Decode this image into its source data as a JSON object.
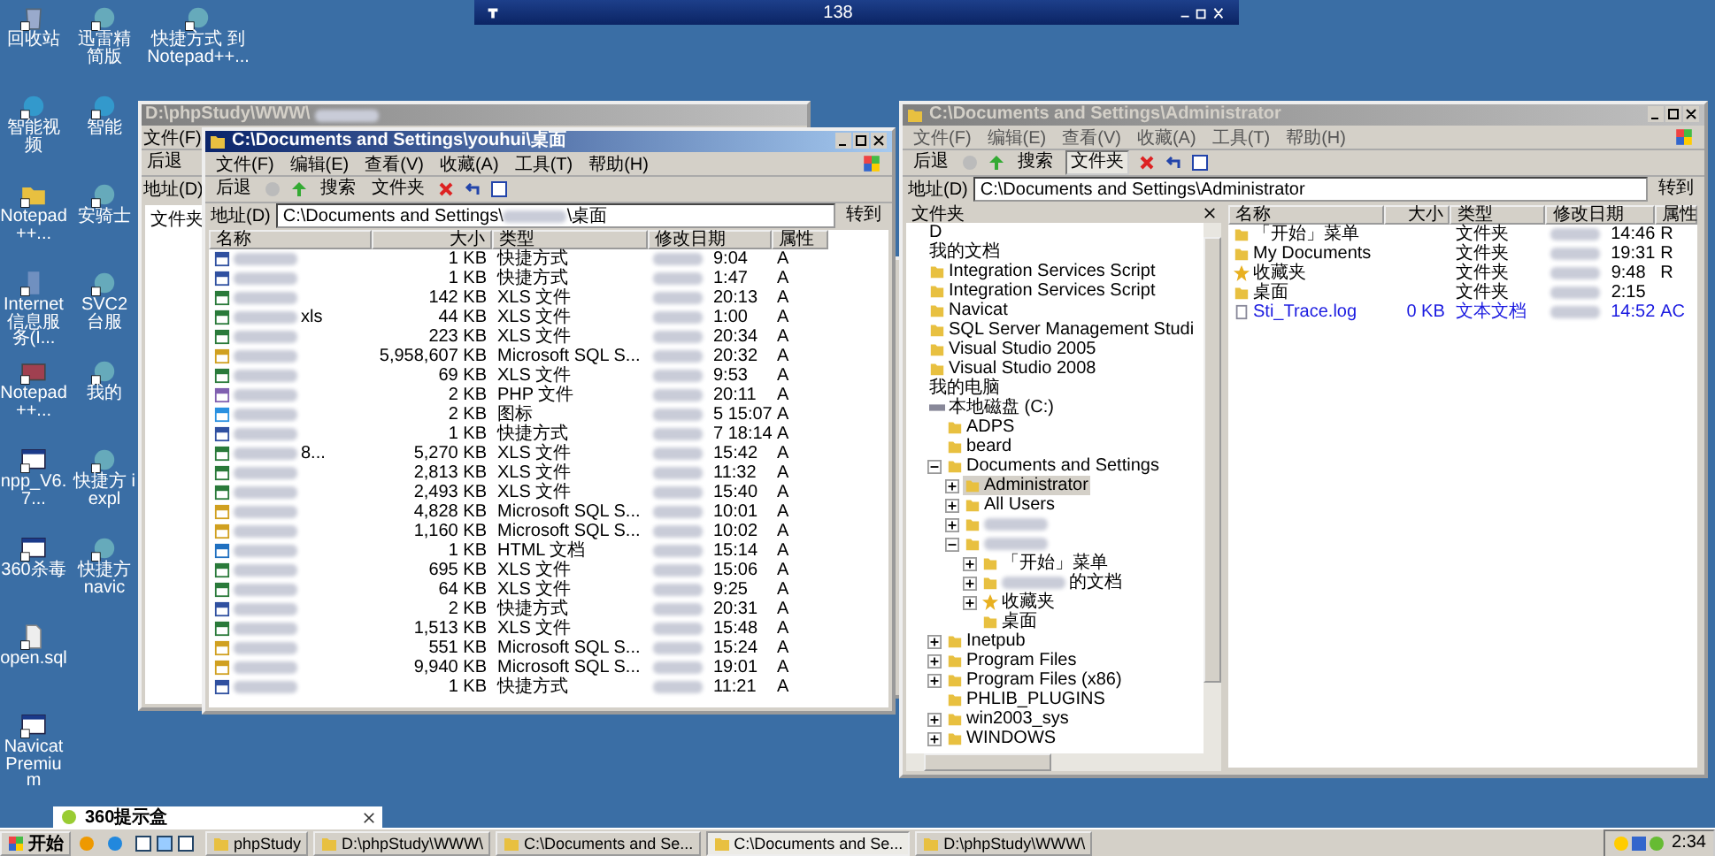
{
  "remote_bar": {
    "host": "138"
  },
  "desktop_columns": [
    [
      {
        "label": "回收站",
        "kind": "recycle"
      },
      {
        "label": "智能视频",
        "kind": "video"
      },
      {
        "label": "Notepad++...",
        "kind": "folder"
      },
      {
        "label": "Internet 信息服务(I...",
        "kind": "server"
      },
      {
        "label": "Notepad++...",
        "kind": "archive"
      },
      {
        "label": "npp_V6.7...",
        "kind": "window"
      },
      {
        "label": "360杀毒",
        "kind": "window"
      },
      {
        "label": "open.sql",
        "kind": "doc"
      },
      {
        "label": "Navicat Premium",
        "kind": "window"
      }
    ],
    [
      {
        "label": "迅雷精简版",
        "kind": "app"
      },
      {
        "label": "智能",
        "kind": "video"
      },
      {
        "label": "安骑士",
        "kind": "app"
      },
      {
        "label": "SVC2 台服",
        "kind": "app"
      },
      {
        "label": "我的",
        "kind": "app"
      },
      {
        "label": "快捷方 iexpl",
        "kind": "app"
      },
      {
        "label": "快捷方 navic",
        "kind": "app"
      }
    ],
    [
      {
        "label": "快捷方式 到 Notepad++...",
        "kind": "app"
      }
    ]
  ],
  "back_window": {
    "title": "D:\\phpStudy\\WWW\\",
    "active": false,
    "menu": "文件(F)",
    "back": "后退",
    "address_label": "地址(D)",
    "folders_label": "文件夹"
  },
  "desktop_window": {
    "title": "C:\\Documents and Settings\\youhui\\桌面",
    "active": true,
    "menu": [
      "文件(F)",
      "编辑(E)",
      "查看(V)",
      "收藏(A)",
      "工具(T)",
      "帮助(H)"
    ],
    "toolbar": {
      "back": "后退",
      "search": "搜索",
      "folders": "文件夹"
    },
    "address": {
      "label": "地址(D)",
      "prefix": "C:\\Documents and Settings\\",
      "suffix": "\\桌面"
    },
    "go": "转到",
    "columns": [
      "名称",
      "大小",
      "类型",
      "修改日期",
      "属性"
    ],
    "rows": [
      {
        "kind": "shortcut",
        "size": "1 KB",
        "type": "快捷方式",
        "time": "9:04",
        "attributes": "A",
        "selected": false
      },
      {
        "kind": "shortcut",
        "size": "1 KB",
        "type": "快捷方式",
        "time": "1:47",
        "attributes": "A",
        "selected": false
      },
      {
        "kind": "sheet",
        "size": "142 KB",
        "type": "XLS 文件",
        "time": "20:13",
        "attributes": "A",
        "selected": false
      },
      {
        "kind": "sheet",
        "name": "xls",
        "size": "44 KB",
        "type": "XLS 文件",
        "time": "1:00",
        "attributes": "A",
        "selected": false
      },
      {
        "kind": "sheet",
        "size": "223 KB",
        "type": "XLS 文件",
        "time": "20:34",
        "attributes": "A",
        "selected": false
      },
      {
        "kind": "script",
        "size": "5,958,607 KB",
        "type": "Microsoft SQL S...",
        "time": "20:32",
        "attributes": "A",
        "selected": false
      },
      {
        "kind": "sheet",
        "size": "69 KB",
        "type": "XLS 文件",
        "time": "9:53",
        "attributes": "A",
        "selected": false
      },
      {
        "kind": "code",
        "size": "2 KB",
        "type": "PHP 文件",
        "time": "20:11",
        "attributes": "A",
        "selected": false
      },
      {
        "kind": "image",
        "size": "2 KB",
        "type": "图标",
        "time": "5 15:07",
        "attributes": "A",
        "selected": false
      },
      {
        "kind": "shortcut",
        "size": "1 KB",
        "type": "快捷方式",
        "time": "7 18:14",
        "attributes": "A",
        "selected": false
      },
      {
        "kind": "sheet",
        "name": "8...",
        "size": "5,270 KB",
        "type": "XLS 文件",
        "time": "15:42",
        "attributes": "A",
        "selected": false
      },
      {
        "kind": "sheet",
        "size": "2,813 KB",
        "type": "XLS 文件",
        "time": "11:32",
        "attributes": "A",
        "selected": false
      },
      {
        "kind": "sheet",
        "size": "2,493 KB",
        "type": "XLS 文件",
        "time": "15:40",
        "attributes": "A",
        "selected": false
      },
      {
        "kind": "script",
        "size": "4,828 KB",
        "type": "Microsoft SQL S...",
        "time": "10:01",
        "attributes": "A",
        "selected": false
      },
      {
        "kind": "script",
        "size": "1,160 KB",
        "type": "Microsoft SQL S...",
        "time": "10:02",
        "attributes": "A",
        "selected": false
      },
      {
        "kind": "web",
        "size": "1 KB",
        "type": "HTML 文档",
        "time": "15:14",
        "attributes": "A",
        "selected": false
      },
      {
        "kind": "sheet",
        "size": "695 KB",
        "type": "XLS 文件",
        "time": "15:06",
        "attributes": "A",
        "selected": false
      },
      {
        "kind": "sheet",
        "size": "64 KB",
        "type": "XLS 文件",
        "time": "9:25",
        "attributes": "A",
        "selected": false
      },
      {
        "kind": "shortcut",
        "size": "2 KB",
        "type": "快捷方式",
        "time": "20:31",
        "attributes": "A",
        "selected": false
      },
      {
        "kind": "sheet",
        "size": "1,513 KB",
        "type": "XLS 文件",
        "time": "15:48",
        "attributes": "A",
        "selected": false
      },
      {
        "kind": "script",
        "size": "551 KB",
        "type": "Microsoft SQL S...",
        "time": "15:24",
        "attributes": "A",
        "selected": false
      },
      {
        "kind": "script",
        "size": "9,940 KB",
        "type": "Microsoft SQL S...",
        "time": "19:01",
        "attributes": "A",
        "selected": false
      },
      {
        "kind": "shortcut",
        "size": "1 KB",
        "type": "快捷方式",
        "time": "11:21",
        "attributes": "A",
        "selected": false
      }
    ]
  },
  "admin_window": {
    "title": "C:\\Documents and Settings\\Administrator",
    "active": false,
    "menu": [
      "文件(F)",
      "编辑(E)",
      "查看(V)",
      "收藏(A)",
      "工具(T)",
      "帮助(H)"
    ],
    "toolbar": {
      "back": "后退",
      "search": "搜索",
      "folders": "文件夹"
    },
    "address": {
      "label": "地址(D)",
      "value": "C:\\Documents and Settings\\Administrator"
    },
    "go": "转到",
    "folders_pane": {
      "title": "文件夹"
    },
    "tree": [
      {
        "label": "D",
        "kind": "text",
        "selected": false
      },
      {
        "label": "我的文档",
        "kind": "text",
        "selected": false
      },
      {
        "label": "Integration Services Script",
        "kind": "folder",
        "selected": false
      },
      {
        "label": "Integration Services Script",
        "kind": "folder",
        "selected": false
      },
      {
        "label": "Navicat",
        "kind": "folder",
        "selected": false
      },
      {
        "label": "SQL Server Management Studi",
        "kind": "folder",
        "selected": false
      },
      {
        "label": "Visual Studio 2005",
        "kind": "folder",
        "selected": false
      },
      {
        "label": "Visual Studio 2008",
        "kind": "folder",
        "selected": false
      },
      {
        "label": "我的电脑",
        "kind": "text",
        "selected": false
      },
      {
        "label": "本地磁盘 (C:)",
        "kind": "drive",
        "selected": false,
        "children": [
          {
            "label": "ADPS",
            "kind": "folder",
            "selected": false
          },
          {
            "label": "beard",
            "kind": "folder",
            "selected": false
          },
          {
            "label": "Documents and Settings",
            "kind": "folder",
            "expanded": true,
            "selected": false,
            "children": [
              {
                "label": "Administrator",
                "kind": "folder",
                "expanded": false,
                "selected": true
              },
              {
                "label": "All Users",
                "kind": "folder",
                "expanded": false,
                "selected": false
              },
              {
                "kind": "masked",
                "expanded": false,
                "selected": false
              },
              {
                "kind": "masked",
                "expanded": true,
                "selected": false,
                "children": [
                  {
                    "label": "「开始」菜单",
                    "kind": "folder",
                    "expanded": false,
                    "selected": false
                  },
                  {
                    "label": "的文档",
                    "kind": "masked",
                    "expanded": false,
                    "selected": false
                  },
                  {
                    "label": "收藏夹",
                    "kind": "star",
                    "expanded": false,
                    "selected": false
                  },
                  {
                    "label": "桌面",
                    "kind": "folder",
                    "selected": false
                  }
                ]
              }
            ]
          },
          {
            "label": "Inetpub",
            "kind": "folder",
            "expanded": false,
            "selected": false
          },
          {
            "label": "Program Files",
            "kind": "folder",
            "expanded": false,
            "selected": false
          },
          {
            "label": "Program Files (x86)",
            "kind": "folder",
            "expanded": false,
            "selected": false
          },
          {
            "label": "PHLIB_PLUGINS",
            "kind": "folder",
            "selected": false
          },
          {
            "label": "win2003_sys",
            "kind": "folder",
            "expanded": false,
            "selected": false
          },
          {
            "label": "WINDOWS",
            "kind": "folder",
            "expanded": false,
            "selected": false
          }
        ]
      }
    ],
    "columns": [
      "名称",
      "大小",
      "类型",
      "修改日期",
      "属性"
    ],
    "rows": [
      {
        "kind": "folder",
        "name": "「开始」菜单",
        "type": "文件夹",
        "time": "14:46",
        "attributes": "R",
        "compressed": false,
        "selected": false
      },
      {
        "kind": "folder",
        "name": "My Documents",
        "type": "文件夹",
        "time": "19:31",
        "attributes": "R",
        "compressed": false,
        "selected": false
      },
      {
        "kind": "star",
        "name": "收藏夹",
        "type": "文件夹",
        "time": "9:48",
        "attributes": "R",
        "compressed": false,
        "selected": false
      },
      {
        "kind": "folder",
        "name": "桌面",
        "type": "文件夹",
        "time": "2:15",
        "compressed": false,
        "selected": false
      },
      {
        "kind": "text",
        "name": "Sti_Trace.log",
        "size": "0 KB",
        "type": "文本文档",
        "time": "14:52",
        "attributes": "AC",
        "compressed": true,
        "selected": false
      }
    ]
  },
  "tip": {
    "title": "360提示盒"
  },
  "taskbar": {
    "start": "开始",
    "tasks": [
      {
        "label": "phpStudy",
        "selected": false
      },
      {
        "label": "D:\\phpStudy\\WWW\\",
        "selected": false
      },
      {
        "label": "C:\\Documents and Se...",
        "selected": false
      },
      {
        "label": "C:\\Documents and Se...",
        "selected": true
      },
      {
        "label": "D:\\phpStudy\\WWW\\",
        "selected": false
      }
    ],
    "clock": "2:34"
  }
}
